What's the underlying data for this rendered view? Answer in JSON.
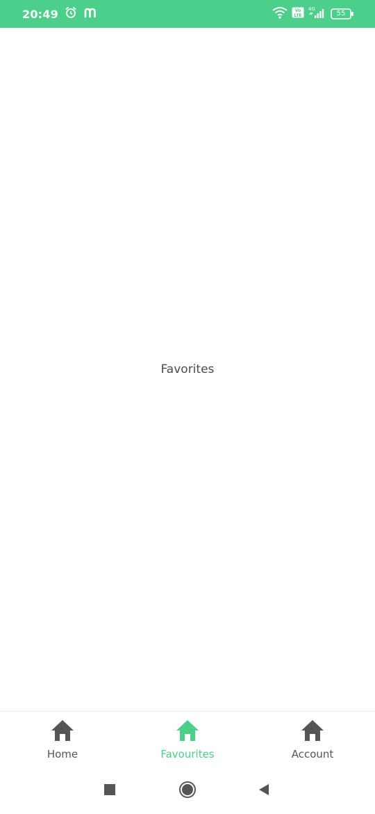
{
  "status_bar": {
    "time": "20:49",
    "battery": "55",
    "network": "4G",
    "volte": "Vo LTE",
    "background_color": "#4bcf8a",
    "icons": [
      "alarm-icon",
      "m-app-icon",
      "wifi-icon",
      "volte-icon",
      "signal-icon",
      "battery-icon"
    ]
  },
  "main": {
    "center_text": "Favorites"
  },
  "bottom_nav": {
    "active_color": "#4bcf8a",
    "inactive_color": "#555555",
    "items": [
      {
        "label": "Home",
        "icon": "home-icon",
        "active": false
      },
      {
        "label": "Favourites",
        "icon": "home-icon",
        "active": true
      },
      {
        "label": "Account",
        "icon": "home-icon",
        "active": false
      }
    ]
  },
  "system_nav": {
    "icons": [
      "recents-square-icon",
      "home-circle-icon",
      "back-triangle-icon"
    ]
  }
}
